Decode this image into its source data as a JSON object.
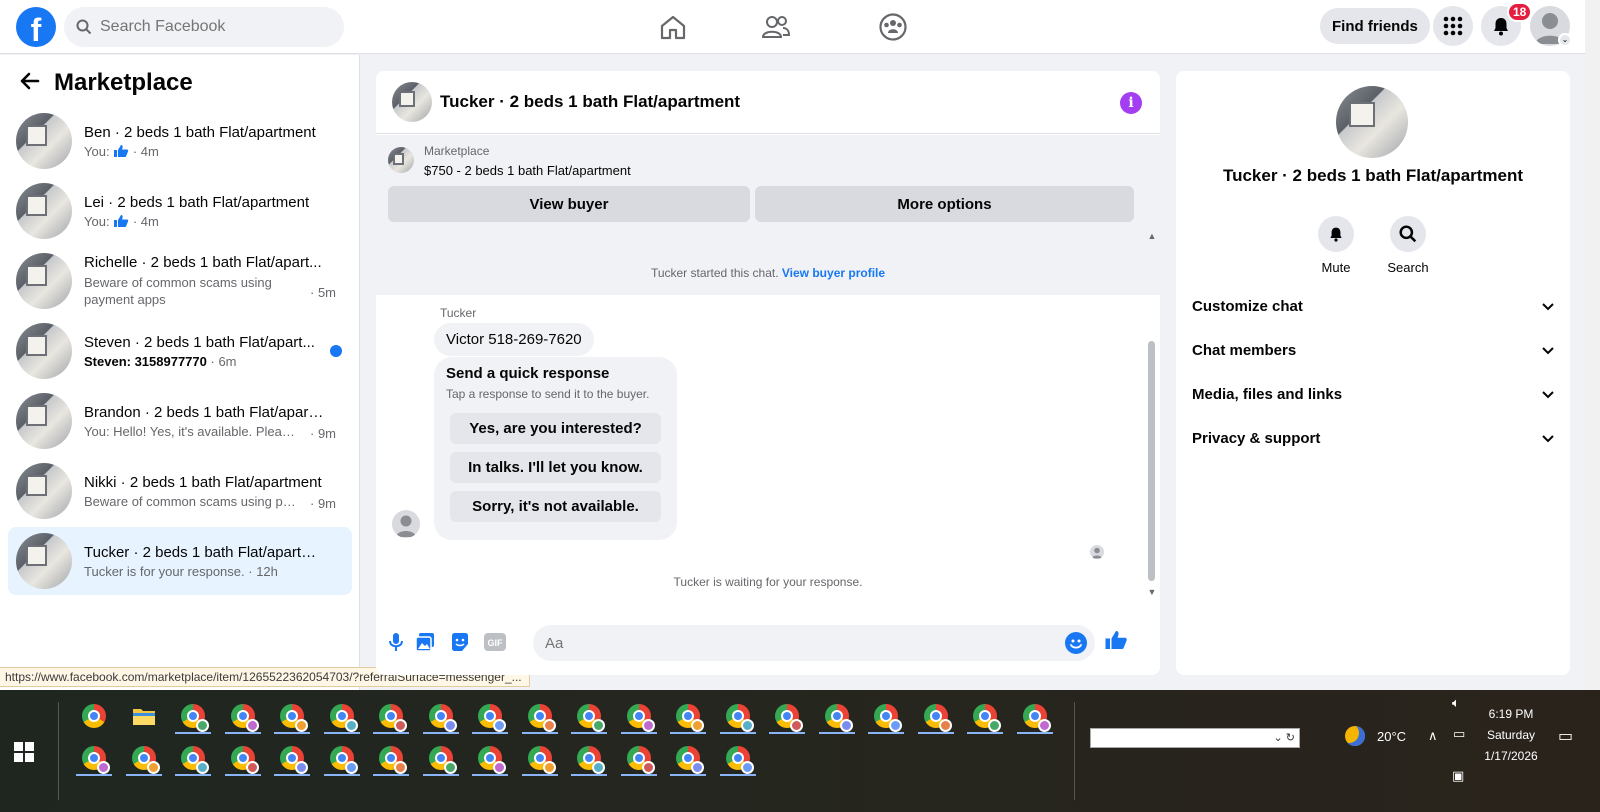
{
  "topbar": {
    "logo_letter": "f",
    "search_placeholder": "Search Facebook",
    "find_friends_label": "Find friends",
    "notification_count": "18"
  },
  "left_panel": {
    "title": "Marketplace",
    "conversations": [
      {
        "title": "Ben · 2 beds 1 bath Flat/apartment",
        "subtitle": "You:",
        "time": "· 4m",
        "like": true
      },
      {
        "title": "Lei · 2 beds 1 bath Flat/apartment",
        "subtitle": "You:",
        "time": "· 4m",
        "like": true
      },
      {
        "title": "Richelle · 2 beds 1 bath Flat/apart...",
        "subtitle": "Beware of common scams using payment apps",
        "time": "· 5m"
      },
      {
        "title": "Steven · 2 beds 1 bath Flat/apart...",
        "subtitle": "Steven: 3158977770",
        "time": "· 6m",
        "unread": true
      },
      {
        "title": "Brandon · 2 beds 1 bath Flat/apart...",
        "subtitle": "You: Hello! Yes, it's available. Please s...",
        "time": "· 9m"
      },
      {
        "title": "Nikki · 2 beds 1 bath Flat/apartment",
        "subtitle": "Beware of common scams using pay...",
        "time": "· 9m"
      },
      {
        "title": "Tucker · 2 beds 1 bath Flat/apartm...",
        "subtitle": "Tucker is for your response.",
        "time": "· 12h",
        "active": true
      }
    ],
    "status_url": "https://www.facebook.com/marketplace/item/1265522362054703/?referralSurface=messenger_..."
  },
  "chat": {
    "title": "Tucker · 2 beds 1 bath Flat/apartment",
    "listing_source": "Marketplace",
    "listing_name": "$750 - 2 beds 1 bath Flat/apartment",
    "view_buyer_label": "View buyer",
    "more_options_label": "More options",
    "started_text": "Tucker started this chat.",
    "view_buyer_profile_label": "View buyer profile",
    "sender_name": "Tucker",
    "message": "Victor 518-269-7620",
    "quick_response_title": "Send a quick response",
    "quick_response_subtitle": "Tap a response to send it to the buyer.",
    "quick_responses": [
      "Yes, are you interested?",
      "In talks. I'll let you know.",
      "Sorry, it's not available."
    ],
    "waiting_text": "Tucker is waiting for your response.",
    "composer_placeholder": "Aa",
    "gif_label": "GIF"
  },
  "right_panel": {
    "title": "Tucker · 2 beds 1 bath Flat/apartment",
    "mute_label": "Mute",
    "search_label": "Search",
    "sections": [
      "Customize chat",
      "Chat members",
      "Media, files and links",
      "Privacy & support"
    ]
  },
  "taskbar": {
    "weather_temp": "20°C",
    "time": "6:19 PM",
    "day": "Saturday",
    "date": "1/17/2026"
  },
  "colors": {
    "facebook_blue": "#1877f2",
    "info_purple": "#a33ef1",
    "active_conv_bg": "#e7f3ff",
    "badge_red": "#e41e3f"
  }
}
